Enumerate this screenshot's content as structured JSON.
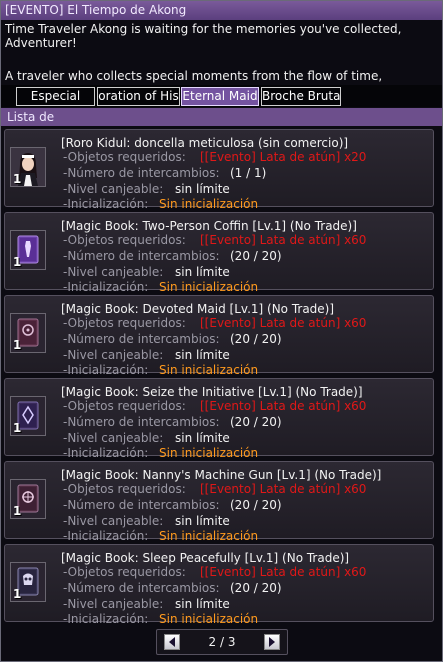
{
  "window": {
    "title": "[EVENTO] El Tiempo de Akong",
    "description": [
      "Time Traveler Akong is waiting for the memories you've collected,",
      "Adventurer!",
      "",
      "A traveler who collects special moments from the flow of time,"
    ]
  },
  "tabs": [
    {
      "label": "Especial",
      "active": false
    },
    {
      "label": "oration of His",
      "active": false
    },
    {
      "label": "Eternal Maid",
      "active": true
    },
    {
      "label": "Broche Brutal",
      "active": false
    }
  ],
  "list_header": "Lista de",
  "labels": {
    "required": "-Objetos requeridos:",
    "exchanges": "-Número de intercambios:",
    "level": "-Nivel canjeable:",
    "reset": "-Inicialización:"
  },
  "items": [
    {
      "name": "[Roro Kidul: doncella meticulosa (sin comercio)]",
      "quantity": "1",
      "icon": "maid-portrait-icon",
      "required": "[[Evento] Lata de atún] x20",
      "exchanges": "(1 / 1)",
      "level": "sin límite",
      "reset": "Sin inicialización"
    },
    {
      "name": "[Magic Book: Two-Person Coffin [Lv.1] (No Trade)]",
      "quantity": "1",
      "icon": "coffin-book-icon",
      "required": "[[Evento] Lata de atún] x60",
      "exchanges": "(20 / 20)",
      "level": "sin límite",
      "reset": "Sin inicialización"
    },
    {
      "name": "[Magic Book: Devoted Maid [Lv.1] (No Trade)]",
      "quantity": "1",
      "icon": "maid-book-icon",
      "required": "[[Evento] Lata de atún] x60",
      "exchanges": "(20 / 20)",
      "level": "sin límite",
      "reset": "Sin inicialización"
    },
    {
      "name": "[Magic Book: Seize the Initiative [Lv.1] (No Trade)]",
      "quantity": "1",
      "icon": "initiative-book-icon",
      "required": "[[Evento] Lata de atún] x60",
      "exchanges": "(20 / 20)",
      "level": "sin límite",
      "reset": "Sin inicialización"
    },
    {
      "name": "[Magic Book: Nanny's Machine Gun [Lv.1] (No Trade)]",
      "quantity": "1",
      "icon": "machine-gun-book-icon",
      "required": "[[Evento] Lata de atún] x60",
      "exchanges": "(20 / 20)",
      "level": "sin límite",
      "reset": "Sin inicialización"
    },
    {
      "name": "[Magic Book: Sleep Peacefully [Lv.1] (No Trade)]",
      "quantity": "1",
      "icon": "sleep-book-icon",
      "required": "[[Evento] Lata de atún] x60",
      "exchanges": "(20 / 20)",
      "level": "sin límite",
      "reset": "Sin inicialización"
    }
  ],
  "pager": {
    "text": "2 / 3"
  },
  "colors": {
    "title_bar": "#6b4d8f",
    "required_value": "#e01818",
    "reset_value": "#ff9a1e",
    "tab_active": "#7453a0"
  }
}
